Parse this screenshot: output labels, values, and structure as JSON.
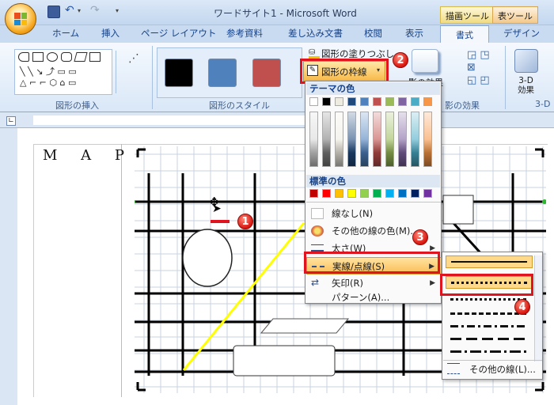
{
  "window": {
    "title": "ワードサイト1 - Microsoft Word"
  },
  "context_tabs": [
    "描画ツール",
    "表ツール"
  ],
  "tabs": [
    "ホーム",
    "挿入",
    "ページ レイアウト",
    "参考資料",
    "差し込み文書",
    "校閲",
    "表示",
    "書式",
    "デザイン"
  ],
  "ribbon": {
    "groups": {
      "insert_shapes": "図形の挿入",
      "shape_styles": "図形のスタイル",
      "shadow_effects": "影の効果",
      "effects_3d": "3-D 効果",
      "effects_3d_short": "3-D"
    },
    "fill_button": "図形の塗りつぶし",
    "outline_button": "図形の枠線",
    "shadow_button": "影の効果",
    "effects_3d_button_line1": "3-D",
    "effects_3d_button_line2": "効果",
    "style_colors": [
      "#000000",
      "#4f81bd",
      "#c0504d"
    ]
  },
  "document": {
    "text": "M A P"
  },
  "outline_menu": {
    "theme_header": "テーマの色",
    "standard_header": "標準の色",
    "theme_top_row": [
      "#ffffff",
      "#000000",
      "#eeece1",
      "#1f497d",
      "#4f81bd",
      "#c0504d",
      "#9bbb59",
      "#8064a2",
      "#4bacc6",
      "#f79646"
    ],
    "standard_colors": [
      "#c00000",
      "#ff0000",
      "#ffc000",
      "#ffff00",
      "#92d050",
      "#00b050",
      "#00b0f0",
      "#0070c0",
      "#002060",
      "#7030a0"
    ],
    "no_line": "線なし(N)",
    "more_colors": "その他の線の色(M)...",
    "weight": "太さ(W)",
    "dashes": "実線/点線(S)",
    "arrows": "矢印(R)",
    "pattern": "パターン(A)..."
  },
  "dash_submenu": {
    "more_lines": "その他の線(L)..."
  },
  "callouts": [
    "1",
    "2",
    "3",
    "4"
  ]
}
